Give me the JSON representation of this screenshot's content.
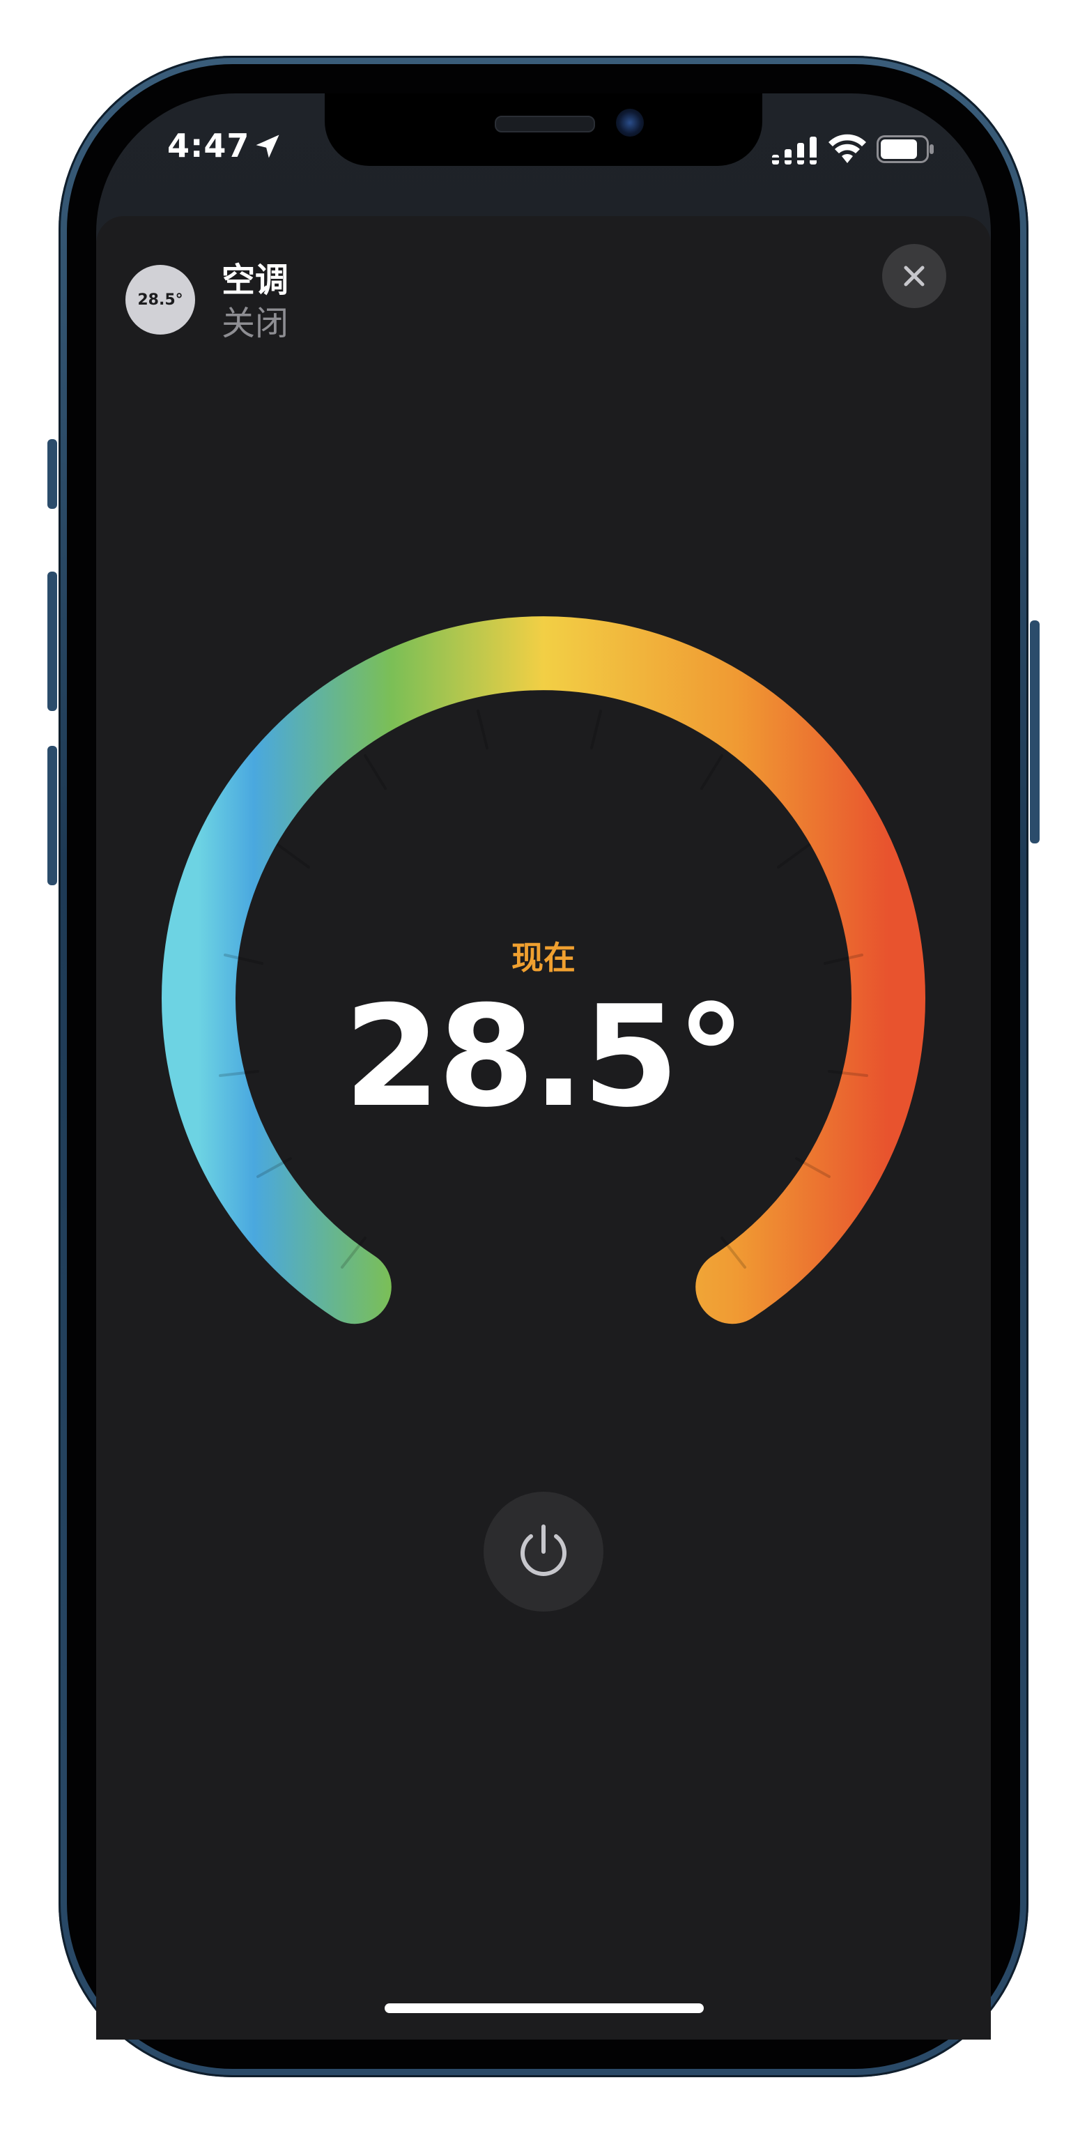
{
  "status_bar": {
    "time": "4:47",
    "location_icon": "location-arrow-icon",
    "signal_icon": "cellular-signal-icon",
    "wifi_icon": "wifi-icon",
    "battery_icon": "battery-icon"
  },
  "accessory": {
    "badge_temp": "28.5°",
    "name": "空调",
    "status": "关闭"
  },
  "dial": {
    "label": "现在",
    "current_temp": "28.5°",
    "gradient_colors": [
      "#6dd3e3",
      "#4aa8df",
      "#7bbf56",
      "#f2cf45",
      "#f09a33",
      "#e8532e"
    ]
  },
  "controls": {
    "close_icon": "close-icon",
    "power_icon": "power-icon"
  },
  "colors": {
    "accent_orange": "#f0a030",
    "sheet_background": "#1c1c1e"
  }
}
